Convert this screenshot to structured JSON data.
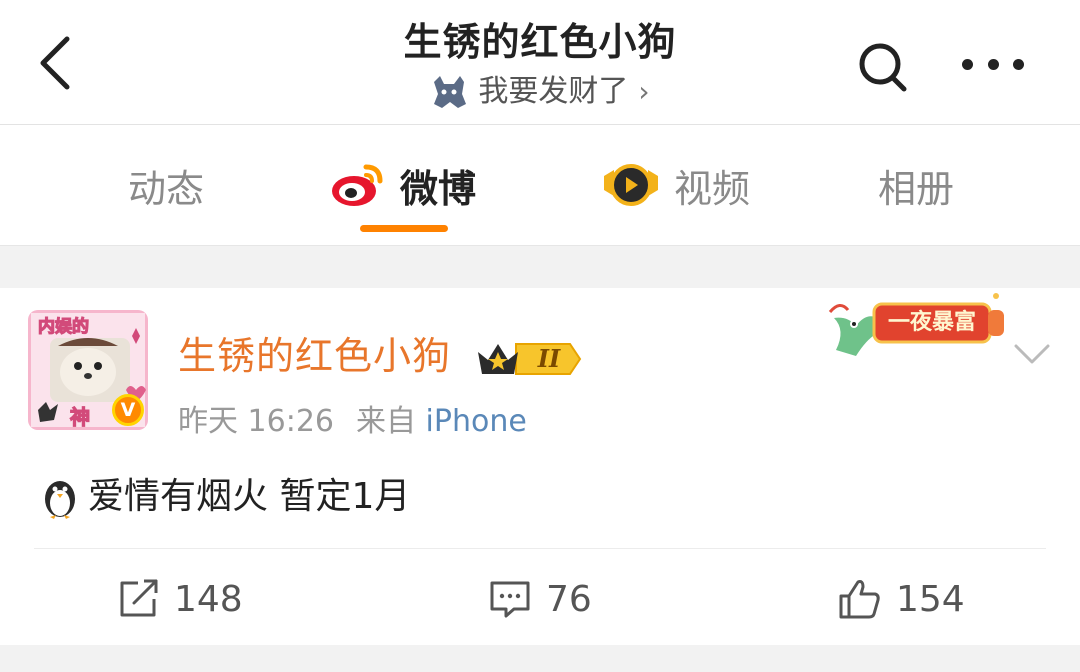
{
  "header": {
    "title": "生锈的红色小狗",
    "subtitle": "我要发财了",
    "subtitle_arrow": "›",
    "icons": [
      "back-icon",
      "search-icon",
      "more-icon",
      "cat-icon"
    ]
  },
  "tabs": [
    {
      "label": "动态",
      "active": false
    },
    {
      "label": "微博",
      "active": true,
      "icon": "weibo-logo-icon"
    },
    {
      "label": "视频",
      "active": false,
      "icon": "video-badge-icon"
    },
    {
      "label": "相册",
      "active": false
    }
  ],
  "post": {
    "username": "生锈的红色小狗",
    "time": "昨天 16:26",
    "source_prefix": "来自",
    "source": "iPhone",
    "content": "爱情有烟火 暂定1月",
    "content_emoji": "penguin-icon",
    "avatar_text_top": "内娱的",
    "avatar_text_bottom": "神",
    "verified_mark": "V",
    "badge_level": "II",
    "promo_text": "一夜暴富",
    "actions": {
      "repost": "148",
      "comment": "76",
      "like": "154"
    }
  },
  "colors": {
    "accent": "#ff8200",
    "username": "#e8762b",
    "link": "#5a88b8",
    "background": "#f2f2f2"
  }
}
